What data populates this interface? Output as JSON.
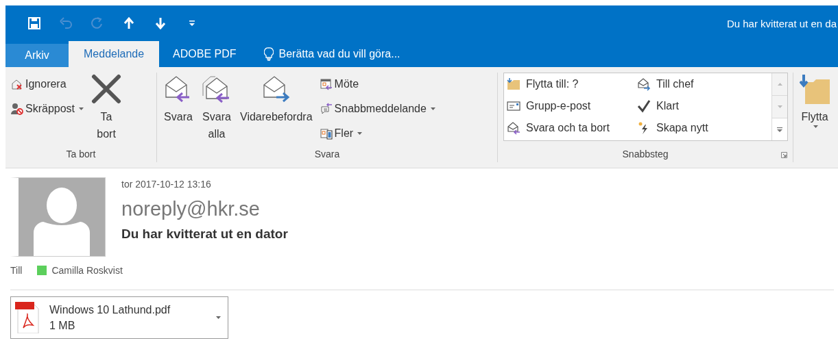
{
  "window": {
    "title": "Du har kvitterat ut en da"
  },
  "quick_access": [
    {
      "kind": "save",
      "disabled": false
    },
    {
      "kind": "undo",
      "disabled": true
    },
    {
      "kind": "redo",
      "disabled": true
    },
    {
      "kind": "up",
      "disabled": false
    },
    {
      "kind": "down",
      "disabled": false
    },
    {
      "kind": "customize",
      "disabled": false
    }
  ],
  "tabs": [
    {
      "label": "Arkiv",
      "kind": "file",
      "selected": false
    },
    {
      "label": "Meddelande",
      "kind": "tab",
      "selected": true
    },
    {
      "label": "ADOBE PDF",
      "kind": "tab",
      "selected": false
    },
    {
      "label": "Berätta vad du vill göra...",
      "kind": "tellme",
      "selected": false
    }
  ],
  "ribbon": {
    "groups": [
      {
        "label": "Ta bort",
        "columns": [
          {
            "kind": "small",
            "items": [
              {
                "label": "Ignorera",
                "kind": "ignore",
                "dropdown": false
              },
              {
                "label": "Skräppost",
                "kind": "junk",
                "dropdown": true
              }
            ]
          },
          {
            "kind": "large",
            "items": [
              {
                "label": "Ta bort",
                "kind": "delete",
                "dropdown": false
              }
            ]
          }
        ]
      },
      {
        "label": "Svara",
        "columns": [
          {
            "kind": "large",
            "items": [
              {
                "label": "Svara",
                "kind": "reply",
                "dropdown": false
              }
            ]
          },
          {
            "kind": "large",
            "items": [
              {
                "label": "Svara alla",
                "kind": "replyall",
                "dropdown": false
              }
            ]
          },
          {
            "kind": "large",
            "items": [
              {
                "label": "Vidarebefordra",
                "kind": "forward",
                "dropdown": false
              }
            ]
          },
          {
            "kind": "small",
            "items": [
              {
                "label": "Möte",
                "kind": "meeting",
                "dropdown": false
              },
              {
                "label": "Snabbmeddelande",
                "kind": "im",
                "dropdown": true
              },
              {
                "label": "Fler",
                "kind": "more",
                "dropdown": true
              }
            ]
          }
        ]
      },
      {
        "label": "Snabbsteg",
        "launcher": true,
        "columns": [
          {
            "kind": "gallery",
            "items": [
              {
                "label": "Flytta till: ?",
                "kind": "movefolder"
              },
              {
                "label": "Till chef",
                "kind": "tomanager"
              },
              {
                "label": "Grupp-e-post",
                "kind": "groupmail"
              },
              {
                "label": "Klart",
                "kind": "done"
              },
              {
                "label": "Svara och ta bort",
                "kind": "replydelete"
              },
              {
                "label": "Skapa nytt",
                "kind": "createnew"
              }
            ]
          }
        ]
      },
      {
        "columns": [
          {
            "kind": "large",
            "items": [
              {
                "label": "Flytta",
                "kind": "movefolderlarge",
                "dropdown": true
              }
            ]
          }
        ]
      }
    ]
  },
  "message": {
    "date": "tor 2017-10-12 13:16",
    "sender": "noreply@hkr.se",
    "subject": "Du har kvitterat ut en dator",
    "to_label": "Till",
    "recipients": [
      {
        "name": "Camilla Roskvist",
        "color": "#5ccf5c"
      }
    ],
    "attachments": [
      {
        "name": "Windows 10 Lathund.pdf",
        "size": "1 MB"
      }
    ]
  }
}
